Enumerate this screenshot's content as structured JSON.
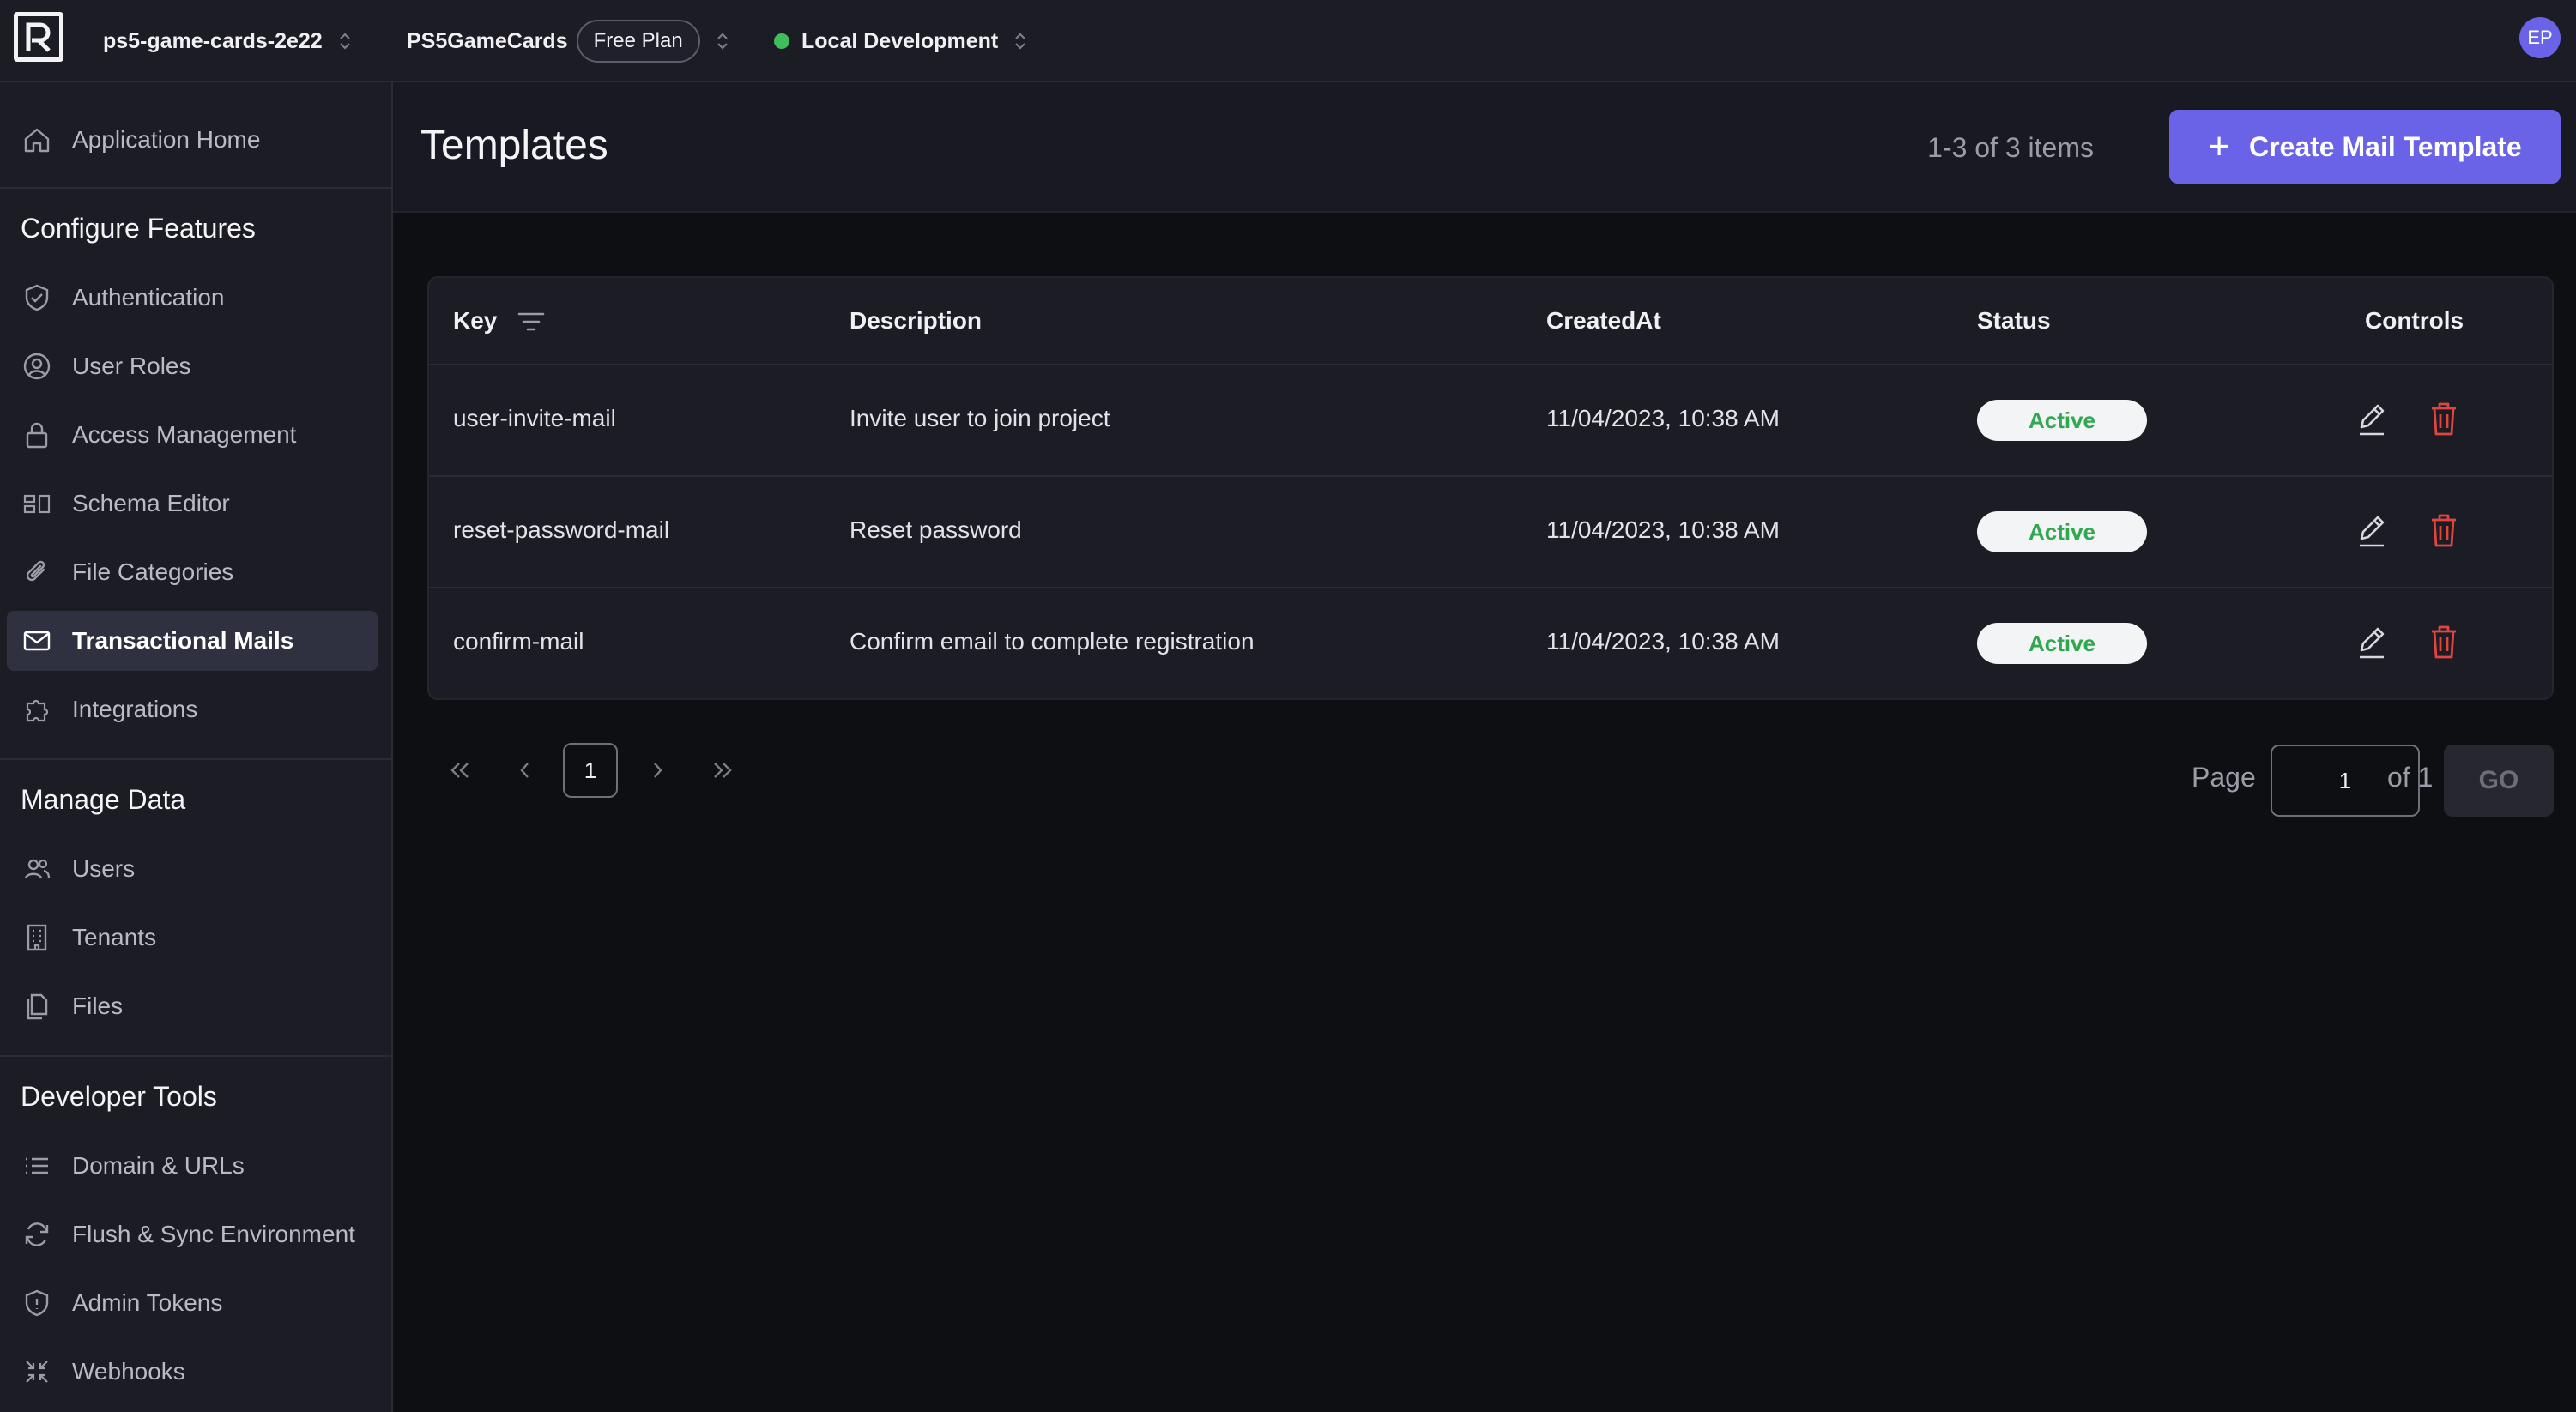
{
  "topbar": {
    "project": "ps5-game-cards-2e22",
    "app_name": "PS5GameCards",
    "plan": "Free Plan",
    "environment": "Local Development",
    "avatar_initials": "EP"
  },
  "sidebar": {
    "home": "Application Home",
    "sections": [
      {
        "title": "Configure Features",
        "items": [
          {
            "label": "Authentication",
            "icon": "shield-check-icon"
          },
          {
            "label": "User Roles",
            "icon": "user-circle-icon"
          },
          {
            "label": "Access Management",
            "icon": "lock-icon"
          },
          {
            "label": "Schema Editor",
            "icon": "schema-icon"
          },
          {
            "label": "File Categories",
            "icon": "paperclip-icon"
          },
          {
            "label": "Transactional Mails",
            "icon": "mail-icon"
          },
          {
            "label": "Integrations",
            "icon": "puzzle-icon"
          }
        ]
      },
      {
        "title": "Manage Data",
        "items": [
          {
            "label": "Users",
            "icon": "users-icon"
          },
          {
            "label": "Tenants",
            "icon": "building-icon"
          },
          {
            "label": "Files",
            "icon": "files-icon"
          }
        ]
      },
      {
        "title": "Developer Tools",
        "items": [
          {
            "label": "Domain & URLs",
            "icon": "list-icon"
          },
          {
            "label": "Flush & Sync Environment",
            "icon": "refresh-icon"
          },
          {
            "label": "Admin Tokens",
            "icon": "shield-icon"
          },
          {
            "label": "Webhooks",
            "icon": "webhook-icon"
          }
        ]
      }
    ],
    "active_item": "Transactional Mails"
  },
  "main": {
    "title": "Templates",
    "item_count": "1-3 of 3 items",
    "create_button": "Create Mail Template",
    "table": {
      "columns": [
        "Key",
        "Description",
        "CreatedAt",
        "Status",
        "Controls"
      ],
      "rows": [
        {
          "key": "user-invite-mail",
          "description": "Invite user to join project",
          "created_at": "11/04/2023, 10:38 AM",
          "status": "Active"
        },
        {
          "key": "reset-password-mail",
          "description": "Reset password",
          "created_at": "11/04/2023, 10:38 AM",
          "status": "Active"
        },
        {
          "key": "confirm-mail",
          "description": "Confirm email to complete registration",
          "created_at": "11/04/2023, 10:38 AM",
          "status": "Active"
        }
      ]
    },
    "pagination": {
      "current_page": "1",
      "page_label": "Page",
      "page_input_value": "1",
      "of_label": "of 1",
      "go_label": "GO"
    }
  },
  "colors": {
    "accent": "#6a63e8",
    "active_status": "#2fa84f",
    "delete": "#e0453f",
    "env_dot": "#3fbf5c"
  }
}
